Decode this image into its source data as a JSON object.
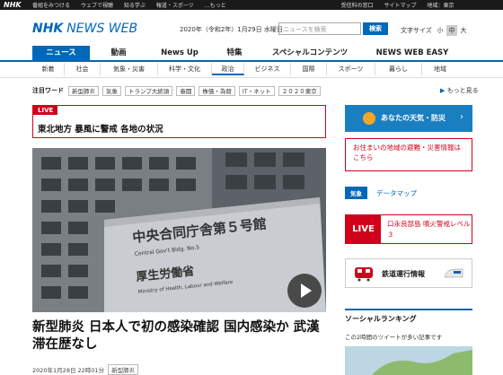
{
  "topbar": {
    "logo": "NHK",
    "links": [
      "番組をみつける",
      "ウェブで視聴",
      "知る学ぶ",
      "報道・スポーツ",
      "…もっと"
    ],
    "search_placeholder": "受信料の窓口",
    "sitemap": "サイトマップ",
    "region": "地域：東京",
    "search_btn": "検索"
  },
  "header": {
    "brand_nhk": "NHK",
    "brand_news": "NEWS WEB",
    "date": "2020年（令和2年）1月29日 水曜日",
    "search_placeholder": "ニュースを検索",
    "search_btn": "検索",
    "font_size_label": "文字サイズ",
    "font_sizes": [
      "小",
      "中",
      "大"
    ]
  },
  "main_nav": [
    {
      "label": "ニュース",
      "active": true
    },
    {
      "label": "動画"
    },
    {
      "label": "News Up"
    },
    {
      "label": "特集"
    },
    {
      "label": "スペシャルコンテンツ"
    },
    {
      "label": "NEWS WEB EASY"
    }
  ],
  "sub_nav": [
    "新着",
    "社会",
    "気象・災害",
    "科学・文化",
    "政治",
    "ビジネス",
    "国際",
    "スポーツ",
    "暮らし",
    "地域"
  ],
  "keywords": {
    "label": "注目ワード",
    "tags": [
      "新型肺炎",
      "気象",
      "トランプ大統領",
      "春闘",
      "株価・為替",
      "IT・ネット",
      "２０２０東京"
    ],
    "more": "もっと見る"
  },
  "live_box": {
    "label": "LIVE",
    "text": "東北地方 暴風に警戒 各地の状況"
  },
  "headline": "新型肺炎 日本人で初の感染確認 国内感染か 武漢滞在歴なし",
  "meta": {
    "date": "2020年1月28日 22時01分",
    "tag": "新型肺炎"
  },
  "sidebar": {
    "weather": "あなたの天気・防災",
    "evac": "お住まいの地域の避難・災害情報はこちら",
    "kisho_label": "気象",
    "kisho_link": "データマップ",
    "live_label": "LIVE",
    "live_text": "口永良部島 噴火警戒レベル３",
    "train": "鉄道運行情報",
    "social_title": "ソーシャルランキング",
    "social_sub": "この2時間のツイートが多い記事です"
  },
  "colors": {
    "brand": "#0068b7",
    "alert": "#d0021b"
  }
}
